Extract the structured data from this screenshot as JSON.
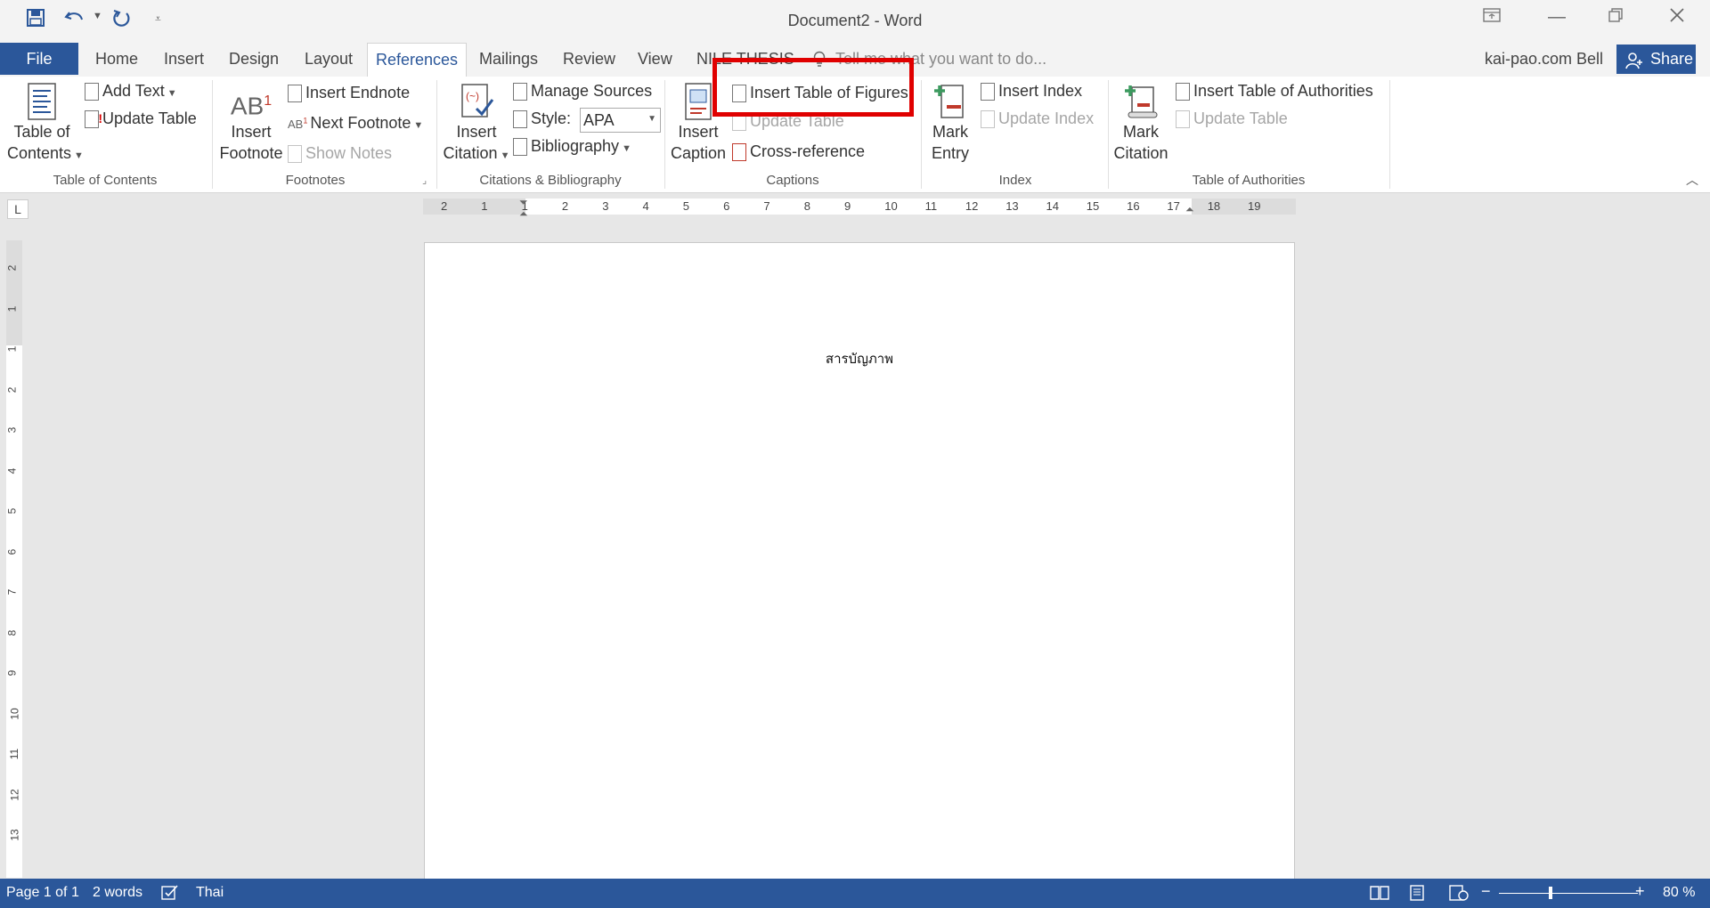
{
  "window": {
    "title": "Document2 - Word"
  },
  "tabs": {
    "file": "File",
    "home": "Home",
    "insert": "Insert",
    "design": "Design",
    "layout": "Layout",
    "references": "References",
    "mailings": "Mailings",
    "review": "Review",
    "view": "View",
    "nile_thesis": "NILE THESIS",
    "tell_me": "Tell me what you want to do...",
    "user": "kai-pao.com Bell",
    "share": "Share"
  },
  "ribbon": {
    "toc": {
      "table_of_contents_1": "Table of",
      "table_of_contents_2": "Contents",
      "add_text": "Add Text",
      "update_table": "Update Table",
      "label": "Table of Contents"
    },
    "footnotes": {
      "insert_footnote_1": "Insert",
      "insert_footnote_2": "Footnote",
      "insert_endnote": "Insert Endnote",
      "next_footnote": "Next Footnote",
      "show_notes": "Show Notes",
      "label": "Footnotes"
    },
    "citations": {
      "insert_citation_1": "Insert",
      "insert_citation_2": "Citation",
      "manage_sources": "Manage Sources",
      "style_label": "Style:",
      "style_value": "APA",
      "bibliography": "Bibliography",
      "label": "Citations & Bibliography"
    },
    "captions": {
      "insert_caption_1": "Insert",
      "insert_caption_2": "Caption",
      "insert_table_of_figures": "Insert Table of Figures",
      "update_table": "Update Table",
      "cross_reference": "Cross-reference",
      "label": "Captions"
    },
    "index": {
      "mark_entry_1": "Mark",
      "mark_entry_2": "Entry",
      "insert_index": "Insert Index",
      "update_index": "Update Index",
      "label": "Index"
    },
    "authorities": {
      "mark_citation_1": "Mark",
      "mark_citation_2": "Citation",
      "insert_table_of_authorities": "Insert Table of Authorities",
      "update_table": "Update Table",
      "label": "Table of Authorities"
    }
  },
  "ruler": {
    "h_ticks": [
      "2",
      "1",
      "1",
      "2",
      "3",
      "4",
      "5",
      "6",
      "7",
      "8",
      "9",
      "10",
      "11",
      "12",
      "13",
      "14",
      "15",
      "16",
      "17",
      "18",
      "19"
    ],
    "v_ticks": [
      "2",
      "1",
      "1",
      "2",
      "3",
      "4",
      "5",
      "6",
      "7",
      "8",
      "9",
      "10",
      "11",
      "12",
      "13"
    ]
  },
  "document": {
    "text": "สารบัญภาพ"
  },
  "status": {
    "page": "Page 1 of 1",
    "words": "2 words",
    "language": "Thai",
    "zoom": "80 %"
  },
  "colors": {
    "accent": "#2b579a",
    "highlight": "#e00000"
  }
}
